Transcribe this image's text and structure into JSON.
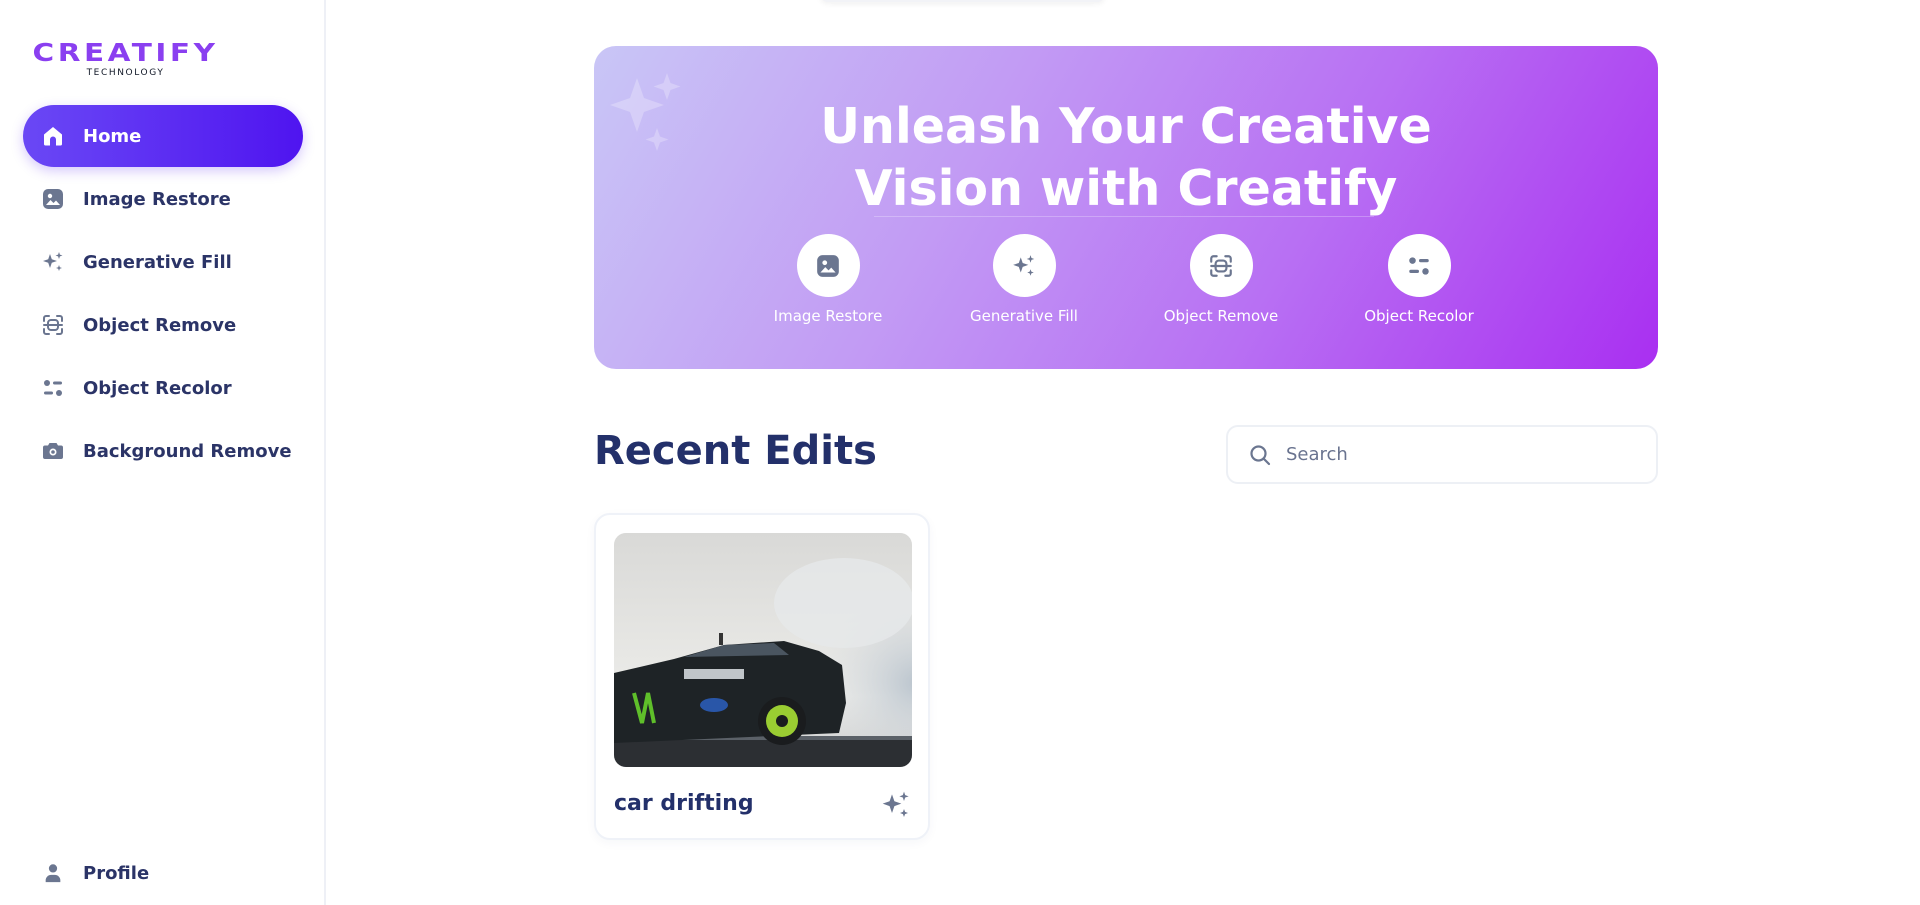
{
  "brand": {
    "name": "CREATIFY",
    "tagline": "TECHNOLOGY",
    "accent": "#8a3ff0"
  },
  "sidebar": {
    "items": [
      {
        "label": "Home",
        "icon": "home-icon",
        "active": true
      },
      {
        "label": "Image Restore",
        "icon": "image-icon"
      },
      {
        "label": "Generative Fill",
        "icon": "sparkles-icon"
      },
      {
        "label": "Object Remove",
        "icon": "object-scan-icon"
      },
      {
        "label": "Object Recolor",
        "icon": "sliders-icon"
      },
      {
        "label": "Background Remove",
        "icon": "camera-icon"
      }
    ],
    "profile": {
      "label": "Profile",
      "icon": "user-icon"
    }
  },
  "hero": {
    "title_line1": "Unleash Your Creative",
    "title_line2": "Vision with Creatify",
    "features": [
      {
        "label": "Image Restore",
        "icon": "image-icon"
      },
      {
        "label": "Generative Fill",
        "icon": "sparkles-icon"
      },
      {
        "label": "Object Remove",
        "icon": "object-scan-icon"
      },
      {
        "label": "Object Recolor",
        "icon": "sliders-icon"
      }
    ],
    "gradient_start": "#c9c6f6",
    "gradient_end": "#a92ff1"
  },
  "recent": {
    "title": "Recent Edits",
    "search_placeholder": "Search",
    "cards": [
      {
        "title": "car drifting",
        "icon": "sparkles-icon"
      }
    ]
  },
  "colors": {
    "active_nav_start": "#6a48f5",
    "active_nav_end": "#4f14f0",
    "text_primary": "#2b3467",
    "icon_muted": "#6b7690"
  }
}
